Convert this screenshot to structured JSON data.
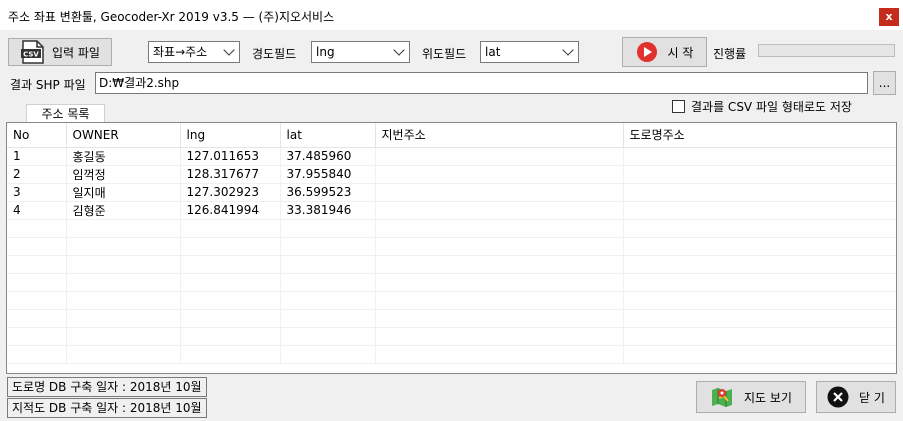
{
  "window": {
    "title": "주소 좌표 변환툴, Geocoder-Xr 2019 v3.5 — (주)지오서비스",
    "close_label": "x"
  },
  "toolbar": {
    "input_file_label": "입력 파일",
    "conversion_mode": "좌표→주소",
    "lng_field_label": "경도필드",
    "lng_field_value": "lng",
    "lat_field_label": "위도필드",
    "lat_field_value": "lat",
    "start_label": "시 작",
    "progress_label": "진행률",
    "progress_value": 0
  },
  "output": {
    "label": "결과 SHP 파일",
    "path": "D:₩결과2.shp",
    "browse_label": "...",
    "csv_checkbox_label": "결과를 CSV 파일 형태로도 저장",
    "csv_checked": false
  },
  "tab": {
    "label": "주소 목록"
  },
  "table": {
    "columns": [
      "No",
      "OWNER",
      "lng",
      "lat",
      "지번주소",
      "도로명주소"
    ],
    "rows": [
      [
        "1",
        "홍길동",
        "127.011653",
        "37.485960",
        "",
        ""
      ],
      [
        "2",
        "임꺽정",
        "128.317677",
        "37.955840",
        "",
        ""
      ],
      [
        "3",
        "일지매",
        "127.302923",
        "36.599523",
        "",
        ""
      ],
      [
        "4",
        "김형준",
        "126.841994",
        "33.381946",
        "",
        ""
      ]
    ]
  },
  "status": {
    "road_db": "도로명 DB 구축 일자 : 2018년 10월",
    "parcel_db": "지적도 DB 구축 일자 : 2018년 10월"
  },
  "footer": {
    "map_view_label": "지도 보기",
    "close_label": "닫 기"
  },
  "colors": {
    "start_icon": "#e03131",
    "close_bg": "#c42b1c",
    "progress_fill": "#06b025"
  }
}
